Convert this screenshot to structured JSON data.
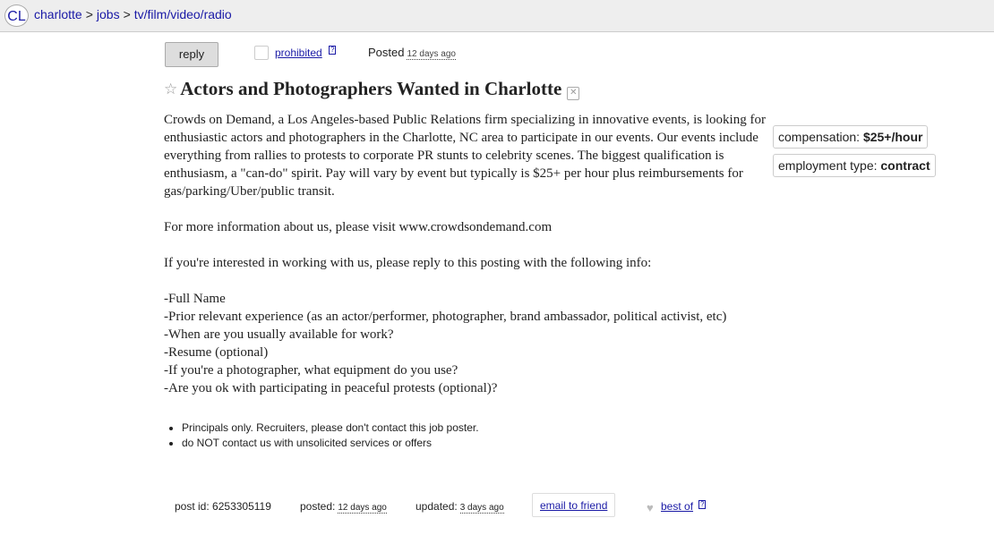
{
  "breadcrumb": {
    "logo": "CL",
    "items": [
      "charlotte",
      "jobs",
      "tv/film/video/radio"
    ],
    "separator": ">"
  },
  "actions": {
    "reply_label": "reply",
    "prohibited_label": "prohibited",
    "help_mark": "?",
    "posted_label": "Posted",
    "posted_ago": "12 days ago"
  },
  "posting": {
    "star_icon": "☆",
    "title": "Actors and Photographers Wanted in Charlotte",
    "hide_icon": "✕",
    "paragraphs": [
      "Crowds on Demand, a Los Angeles-based Public Relations firm specializing in innovative events, is looking for enthusiastic actors and photographers in the Charlotte, NC area to participate in our events. Our events include everything from rallies to protests to corporate PR stunts to celebrity scenes. The biggest qualification is enthusiasm, a \"can-do\" spirit. Pay will vary by event but typically is $25+ per hour plus reimbursements for gas/parking/Uber/public transit.",
      "For more information about us, please visit www.crowdsondemand.com",
      "If you're interested in working with us, please reply to this posting with the following info:"
    ],
    "requested_info": [
      "-Full Name",
      "-Prior relevant experience (as an actor/performer, photographer, brand ambassador, political activist, etc)",
      "-When are you usually available for work?",
      "-Resume (optional)",
      "-If you're a photographer, what equipment do you use?",
      "-Are you ok with participating in peaceful protests (optional)?"
    ]
  },
  "attributes": {
    "compensation_label": "compensation:",
    "compensation_value": "$25+/hour",
    "employment_label": "employment type:",
    "employment_value": "contract"
  },
  "notices": [
    "Principals only. Recruiters, please don't contact this job poster.",
    "do NOT contact us with unsolicited services or offers"
  ],
  "footer": {
    "post_id_label": "post id:",
    "post_id": "6253305119",
    "posted_label": "posted:",
    "posted_ago": "12 days ago",
    "updated_label": "updated:",
    "updated_ago": "3 days ago",
    "email_friend": "email to friend",
    "heart_icon": "♥",
    "best_of": "best of",
    "help_mark": "?"
  },
  "colors": {
    "link": "#1a1aa6",
    "topbar_bg": "#eeeeee",
    "button_bg": "#dddddd"
  }
}
